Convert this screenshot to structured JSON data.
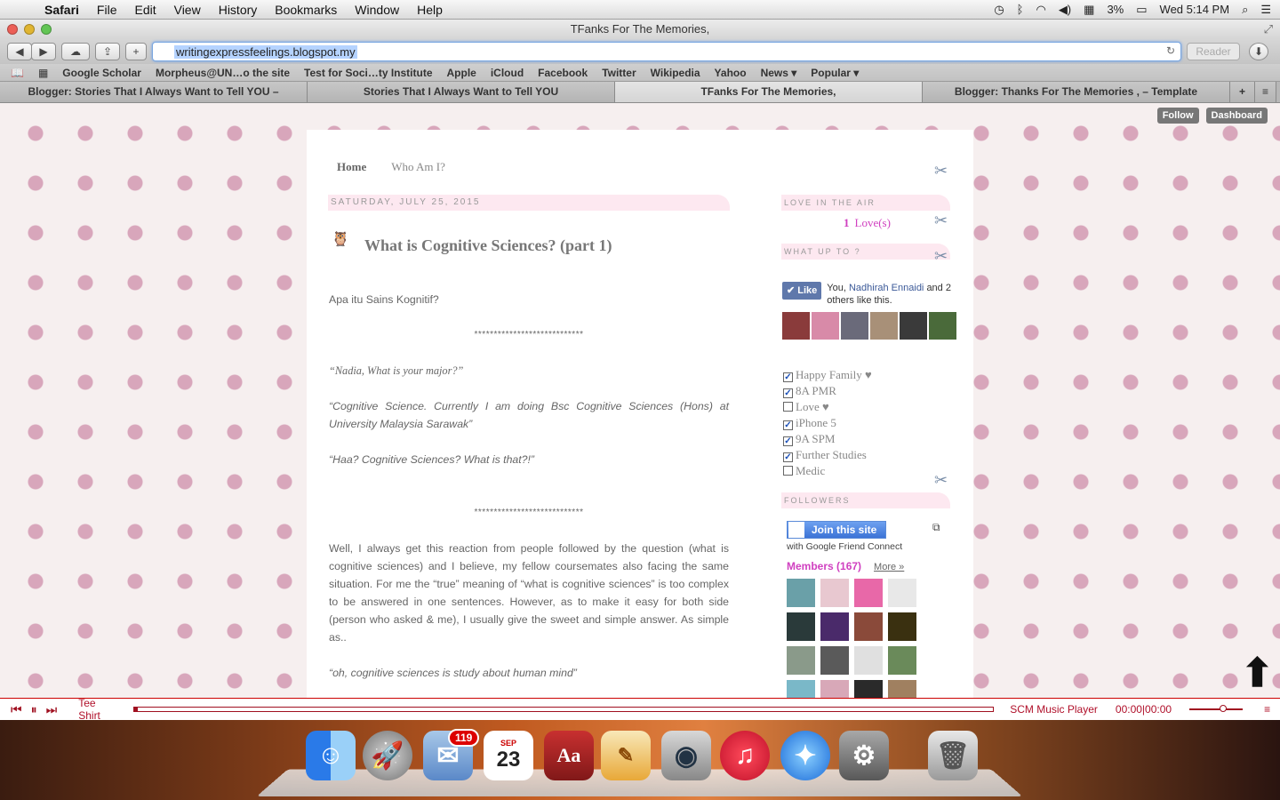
{
  "menubar": {
    "app": "Safari",
    "items": [
      "File",
      "Edit",
      "View",
      "History",
      "Bookmarks",
      "Window",
      "Help"
    ],
    "battery": "3%",
    "clock": "Wed 5:14 PM"
  },
  "window": {
    "title": "TFanks For The Memories,"
  },
  "toolbar": {
    "url": "writingexpressfeelings.blogspot.my",
    "reader": "Reader"
  },
  "bookmarks": [
    "Google Scholar",
    "Morpheus@UN…o the site",
    "Test for Soci…ty Institute",
    "Apple",
    "iCloud",
    "Facebook",
    "Twitter",
    "Wikipedia",
    "Yahoo",
    "News ▾",
    "Popular ▾"
  ],
  "tabs": [
    {
      "label": "Blogger: Stories That I Always Want to Tell YOU –"
    },
    {
      "label": "Stories That I Always Want to Tell YOU"
    },
    {
      "label": "TFanks For The Memories,"
    },
    {
      "label": "Blogger: Thanks For The Memories , – Template"
    }
  ],
  "bloggerbar": {
    "follow": "Follow",
    "dashboard": "Dashboard"
  },
  "blog": {
    "nav": [
      "Home",
      "Who Am I?"
    ],
    "date": "SATURDAY, JULY 25, 2015",
    "post_title": "What is Cognitive Sciences? (part 1)",
    "paragraphs": {
      "p1": "Apa itu Sains Kognitif?",
      "stars1": "****************************",
      "q1": "“Nadia, What is your major?”",
      "q2": "“Cognitive Science. Currently I am doing Bsc Cognitive Sciences (Hons) at University Malaysia Sarawak”",
      "q3": "“Haa? Cognitive Sciences? What is that?!”",
      "stars2": "****************************",
      "p2": "Well, I always get this reaction from people followed by the question (what is cognitive sciences) and I believe, my fellow coursemates also facing the same situation. For me the “true” meaning of “what is cognitive sciences” is too complex to be answered in one sentences. However, as to make it easy for both side (person who asked & me), I usually give the sweet and simple answer. As simple as..",
      "q4": "“oh, cognitive sciences is study about human mind”"
    }
  },
  "sidebar": {
    "love_heading": "LOVE IN THE AIR",
    "love_count": "1",
    "love_label": "Love(s)",
    "whatup_heading": "WHAT UP TO ?",
    "like_button": "Like",
    "like_text_pre": "You,",
    "like_name": "Nadhirah Ennaidi",
    "like_text_post": "and 2 others like this.",
    "checklist": [
      {
        "label": "Happy Family ♥",
        "checked": true
      },
      {
        "label": "8A PMR",
        "checked": true
      },
      {
        "label": "Love ♥",
        "checked": false
      },
      {
        "label": "iPhone 5",
        "checked": true
      },
      {
        "label": "9A SPM",
        "checked": true
      },
      {
        "label": "Further Studies",
        "checked": true
      },
      {
        "label": "Medic",
        "checked": false
      }
    ],
    "followers_heading": "FOLLOWERS",
    "join_button": "Join this site",
    "join_sub": "with Google Friend Connect",
    "members": "Members (167)",
    "more": "More »"
  },
  "player": {
    "song": "Tee Shirt",
    "name": "SCM Music Player",
    "time": "00:00|00:00"
  },
  "dock": {
    "mail_badge": "119",
    "calendar_month": "SEP",
    "calendar_day": "23"
  },
  "colors": {
    "accent_pink": "#d040c0",
    "player_red": "#b0102a",
    "polka_dot": "#d8a6bb"
  }
}
